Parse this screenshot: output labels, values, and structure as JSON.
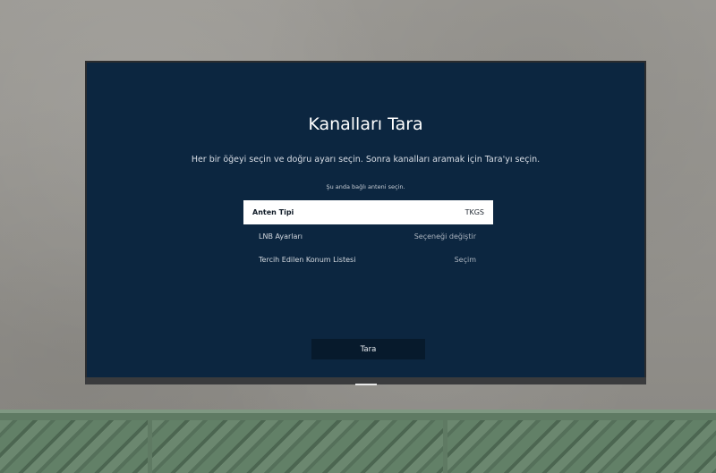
{
  "screen": {
    "title": "Kanalları Tara",
    "subtitle": "Her bir öğeyi seçin ve doğru ayarı seçin. Sonra kanalları aramak için Tara'yı seçin.",
    "hint": "Şu anda bağlı anteni seçin.",
    "settings": [
      {
        "label": "Anten Tipi",
        "value": "TKGS",
        "selected": true
      },
      {
        "label": "LNB Ayarları",
        "value": "Seçeneği değiştir",
        "selected": false
      },
      {
        "label": "Tercih Edilen Konum Listesi",
        "value": "Seçim",
        "selected": false
      }
    ],
    "scan_button": "Tara"
  },
  "colors": {
    "screen_background": "#0c2640",
    "selected_row": "#ffffff",
    "button_background": "#071a2c",
    "cabinet_green": "#5f7a63"
  },
  "icons": []
}
